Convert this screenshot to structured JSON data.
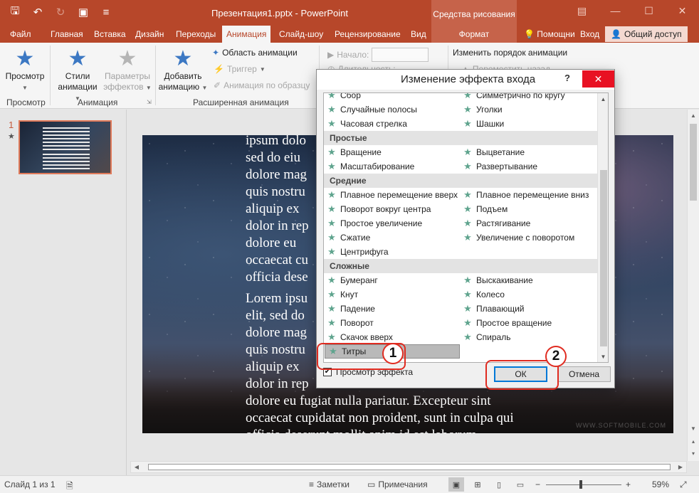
{
  "titlebar": {
    "doc_title": "Презентация1.pptx - PowerPoint",
    "context_title": "Средства рисования"
  },
  "qat": {
    "icons": [
      "save-icon",
      "undo-icon",
      "redo-icon",
      "present-icon",
      "customize-icon"
    ]
  },
  "tabs": [
    {
      "label": "Файл"
    },
    {
      "label": "Главная"
    },
    {
      "label": "Вставка"
    },
    {
      "label": "Дизайн"
    },
    {
      "label": "Переходы"
    },
    {
      "label": "Анимация"
    },
    {
      "label": "Слайд-шоу"
    },
    {
      "label": "Рецензирование"
    },
    {
      "label": "Вид"
    },
    {
      "label": "Формат"
    }
  ],
  "tab_right": {
    "help": "Помощни",
    "login": "Вход",
    "share": "Общий доступ"
  },
  "ribbon": {
    "preview": "Просмотр",
    "styles_line1": "Стили",
    "styles_line2": "анимации",
    "params_line1": "Параметры",
    "params_line2": "эффектов",
    "add_line1": "Добавить",
    "add_line2": "анимацию",
    "anim_pane": "Область анимации",
    "trigger": "Триггер",
    "painter": "Анимация по образцу",
    "start_label": "Начало:",
    "duration_label": "Длительность:",
    "reorder": "Изменить порядок анимации",
    "move_earlier": "Переместить назад",
    "groups": {
      "preview": "Просмотр",
      "animation": "Анимация",
      "advanced": "Расширенная анимация"
    }
  },
  "thumbnail": {
    "number": "1",
    "star": "★"
  },
  "slide": {
    "paragraphs": [
      "ipsum dolo\nsed do eiu\ndolore mag\nquis nostru\naliquip ex\ndolor in rep\ndolore eu\noccaecat cu\nofficia dese",
      "Lorem ipsu\nelit, sed do\ndolore mag\nquis nostru\naliquip ex\ndolor in rep\ndolore eu fugiat nulla pariatur. Excepteur sint\noccaecat cupidatat non proident, sunt in culpa qui\nofficia deserunt mollit anim id est laborum."
    ],
    "watermark": "WWW.SOFTMOBILE.COM"
  },
  "dialog": {
    "title": "Изменение эффекта входа",
    "help": "?",
    "close": "✕",
    "rows": [
      {
        "type": "row",
        "left": "Сбор",
        "right": "Симметрично по кругу"
      },
      {
        "type": "row",
        "left": "Случайные полосы",
        "right": "Уголки"
      },
      {
        "type": "row",
        "left": "Часовая стрелка",
        "right": "Шашки"
      },
      {
        "type": "header",
        "label": "Простые"
      },
      {
        "type": "row",
        "left": "Вращение",
        "right": "Выцветание"
      },
      {
        "type": "row",
        "left": "Масштабирование",
        "right": "Развертывание"
      },
      {
        "type": "header",
        "label": "Средние"
      },
      {
        "type": "row",
        "left": "Плавное перемещение вверх",
        "right": "Плавное перемещение вниз"
      },
      {
        "type": "row",
        "left": "Поворот вокруг центра",
        "right": "Подъем"
      },
      {
        "type": "row",
        "left": "Простое увеличение",
        "right": "Растягивание"
      },
      {
        "type": "row",
        "left": "Сжатие",
        "right": "Увеличение с поворотом"
      },
      {
        "type": "row",
        "left": "Центрифуга",
        "right": ""
      },
      {
        "type": "header",
        "label": "Сложные"
      },
      {
        "type": "row",
        "left": "Бумеранг",
        "right": "Выскакивание"
      },
      {
        "type": "row",
        "left": "Кнут",
        "right": "Колесо"
      },
      {
        "type": "row",
        "left": "Падение",
        "right": "Плавающий"
      },
      {
        "type": "row",
        "left": "Поворот",
        "right": "Простое вращение"
      },
      {
        "type": "row",
        "left": "Скачок вверх",
        "right": "Спираль"
      },
      {
        "type": "row",
        "left": "Титры",
        "right": "",
        "selected": true
      }
    ],
    "preview_label": "Просмотр эффекта",
    "preview_checked": true,
    "ok": "ОК",
    "cancel": "Отмена"
  },
  "callouts": {
    "one": "1",
    "two": "2"
  },
  "status": {
    "slide_info": "Слайд 1 из 1",
    "notes": "Заметки",
    "comments": "Примечания",
    "zoom": "59%"
  },
  "colors": {
    "accent": "#b7472a",
    "star": "#5fa48e",
    "callout": "#e02b20",
    "ok_border": "#0078d7"
  }
}
